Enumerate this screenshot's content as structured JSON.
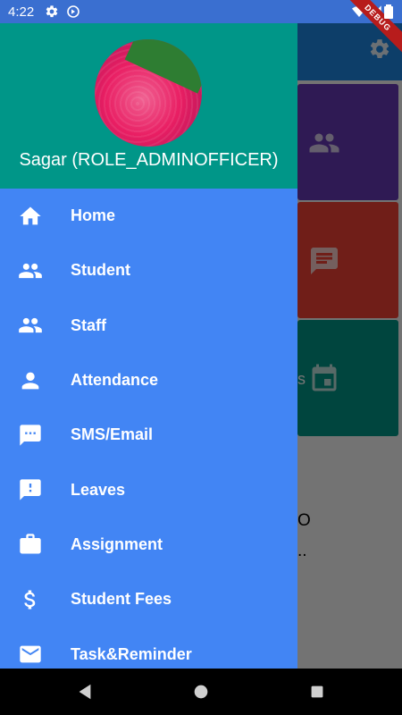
{
  "status_bar": {
    "time": "4:22",
    "icons": [
      "gear-icon",
      "sync-icon",
      "wifi-icon",
      "signal-icon",
      "battery-icon"
    ],
    "debug_banner": "DEBUG"
  },
  "background": {
    "tile_3_text": "s",
    "fragment_1": "O",
    "fragment_2": ".."
  },
  "drawer": {
    "header_color": "#009688",
    "body_color": "#4285f4",
    "user_name": "Sagar (ROLE_ADMINOFFICER)",
    "items": [
      {
        "label": "Home",
        "icon": "home-icon"
      },
      {
        "label": "Student",
        "icon": "people-icon"
      },
      {
        "label": "Staff",
        "icon": "people-icon"
      },
      {
        "label": "Attendance",
        "icon": "person-icon"
      },
      {
        "label": "SMS/Email",
        "icon": "message-icon"
      },
      {
        "label": "Leaves",
        "icon": "feedback-icon"
      },
      {
        "label": "Assignment",
        "icon": "briefcase-icon"
      },
      {
        "label": "Student Fees",
        "icon": "dollar-icon"
      },
      {
        "label": "Task&Reminder",
        "icon": "mail-icon"
      }
    ]
  }
}
